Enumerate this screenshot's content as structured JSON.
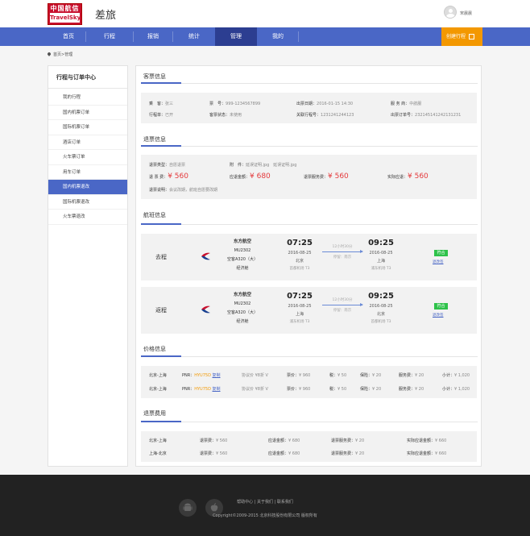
{
  "header": {
    "logo_cn": "中国航信",
    "logo_en": "TravelSky",
    "app_title": "差旅",
    "username": "宋晨晨"
  },
  "nav": {
    "items": [
      {
        "label": "首页",
        "active": false
      },
      {
        "label": "行程",
        "active": false
      },
      {
        "label": "报销",
        "active": false
      },
      {
        "label": "统计",
        "active": false
      },
      {
        "label": "管理",
        "active": true
      },
      {
        "label": "我的",
        "active": false
      }
    ],
    "create_label": "创建行程"
  },
  "breadcrumb": "首页>管理",
  "sidebar": {
    "title": "行程与订单中心",
    "items": [
      {
        "label": "我的行程",
        "active": false
      },
      {
        "label": "国内机票订单",
        "active": false
      },
      {
        "label": "国际机票订单",
        "active": false
      },
      {
        "label": "酒店订单",
        "active": false
      },
      {
        "label": "火车票订单",
        "active": false
      },
      {
        "label": "用车订单",
        "active": false
      },
      {
        "label": "国内机票退改",
        "active": true
      },
      {
        "label": "国际机票退改",
        "active": false
      },
      {
        "label": "火车票退改",
        "active": false
      }
    ]
  },
  "sections": {
    "customer": "客票信息",
    "refund": "退票信息",
    "flight": "航班信息",
    "price": "价格信息",
    "fee": "退票费用"
  },
  "customer": {
    "passenger_label": "乘　客：",
    "passenger": "张三",
    "ticket_label": "票　号：",
    "ticket": "999-1234567899",
    "issue_label": "出票日期：",
    "issue": "2016-01-15 14:30",
    "service_label": "服 务 商：",
    "service": "中航服",
    "trip_label": "行程单：",
    "trip": "已开",
    "status_label": "客票状态：",
    "status": "未使用",
    "assoc_label": "关联行程号：",
    "assoc": "1231241244123",
    "order_label": "出票订单号：",
    "order": "23214514124213123​1"
  },
  "refund": {
    "type_label": "退票类型：",
    "type": "自愿退票",
    "attach_label": "附　件：",
    "attach1": "延误证明.jpg",
    "attach2": "延误证明.jpg",
    "fee_label": "退 票 费：",
    "fee": "¥ 560",
    "due_label": "应退金额：",
    "due": "¥ 680",
    "service_label": "退票服务费：",
    "service": "¥ 560",
    "actual_label": "实际应退：",
    "actual": "¥ 560",
    "note_label": "退票说明：",
    "note": "会议改期，航班自愿要改期"
  },
  "flights": [
    {
      "trip": "去程",
      "airline": "东方航空",
      "flight_no": "MU2302",
      "plane": "空客A320（大）",
      "cabin": "经济舱",
      "dep_time": "07:25",
      "dep_date": "2016-08-25",
      "dep_city": "北京",
      "dep_airport": "首都机场 T3",
      "duration": "12小时30分",
      "stop": "停留：南京",
      "arr_time": "09:25",
      "arr_date": "2016-08-25",
      "arr_city": "上海",
      "arr_airport": "浦东机场 T3",
      "badge": "符合",
      "rule": "退改签"
    },
    {
      "trip": "返程",
      "airline": "东方航空",
      "flight_no": "MU2302",
      "plane": "空客A320（大）",
      "cabin": "经济舱",
      "dep_time": "07:25",
      "dep_date": "2016-08-25",
      "dep_city": "上海",
      "dep_airport": "浦东机场 T3",
      "duration": "12小时30分",
      "stop": "停留：南京",
      "arr_time": "09:25",
      "arr_date": "2016-08-25",
      "arr_city": "北京",
      "arr_airport": "首都机场 T3",
      "badge": "符合",
      "rule": "退改签"
    }
  ],
  "price_rows": [
    {
      "route": "北京-上海",
      "pnr_label": "PNR：",
      "pnr": "HYU75D",
      "copy": "复制",
      "agreement": "协议价 ¥8折 V",
      "fare_label": "票价：",
      "fare": "¥ 960",
      "tax_label": "税：",
      "tax": "¥ 50",
      "ins_label": "保险：",
      "ins": "¥ 20",
      "svc_label": "服务费：",
      "svc": "¥ 20",
      "sub_label": "小计：",
      "sub": "¥ 1,020"
    },
    {
      "route": "北京-上海",
      "pnr_label": "PNR：",
      "pnr": "HYU75D",
      "copy": "复制",
      "agreement": "协议价 ¥8折 V",
      "fare_label": "票价：",
      "fare": "¥ 960",
      "tax_label": "税：",
      "tax": "¥ 50",
      "ins_label": "保险：",
      "ins": "¥ 20",
      "svc_label": "服务费：",
      "svc": "¥ 20",
      "sub_label": "小计：",
      "sub": "¥ 1,020"
    }
  ],
  "fee_rows": [
    {
      "route": "北京-上海",
      "refund_label": "退票费：",
      "refund": "¥ 560",
      "due_label": "应退金额：",
      "due": "¥ 680",
      "svc_label": "退票服务费：",
      "svc": "¥ 20",
      "actual_label": "实际应退金额：",
      "actual": "¥ 660"
    },
    {
      "route": "上海-北京",
      "refund_label": "退票费：",
      "refund": "¥ 560",
      "due_label": "应退金额：",
      "due": "¥ 680",
      "svc_label": "退票服务费：",
      "svc": "¥ 20",
      "actual_label": "实际应退金额：",
      "actual": "¥ 660"
    }
  ],
  "footer": {
    "links": [
      "帮助中心",
      "关于我们",
      "联系我们"
    ],
    "copyright": "Copyright©2009-2015 北京科技股份有限公司 版权所有"
  },
  "colors": {
    "brand_blue": "#4a67c6",
    "nav_active": "#2c3e91",
    "create_orange": "#f39800",
    "price_red": "#e4393c",
    "badge_green": "#2ec24a"
  }
}
